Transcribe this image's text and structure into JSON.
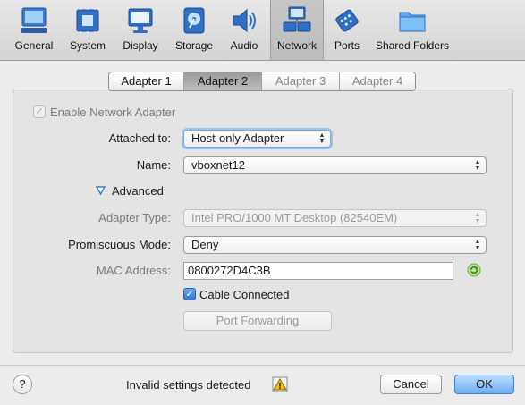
{
  "toolbar": {
    "items": [
      {
        "label": "General",
        "icon": "monitor-general-icon"
      },
      {
        "label": "System",
        "icon": "chip-icon"
      },
      {
        "label": "Display",
        "icon": "display-icon"
      },
      {
        "label": "Storage",
        "icon": "disk-icon"
      },
      {
        "label": "Audio",
        "icon": "speaker-icon"
      },
      {
        "label": "Network",
        "icon": "network-icon"
      },
      {
        "label": "Ports",
        "icon": "ports-icon"
      },
      {
        "label": "Shared Folders",
        "icon": "folder-icon"
      }
    ],
    "active": "Network"
  },
  "tabs": [
    "Adapter 1",
    "Adapter 2",
    "Adapter 3",
    "Adapter 4"
  ],
  "selected_tab": "Adapter 2",
  "form": {
    "enable_adapter_label": "Enable Network Adapter",
    "attached_to_label": "Attached to:",
    "attached_to_value": "Host-only Adapter",
    "name_label": "Name:",
    "name_value": "vboxnet12",
    "advanced_label": "Advanced",
    "adapter_type_label": "Adapter Type:",
    "adapter_type_value": "Intel PRO/1000 MT Desktop (82540EM)",
    "promiscuous_label": "Promiscuous Mode:",
    "promiscuous_value": "Deny",
    "mac_label": "MAC Address:",
    "mac_value": "0800272D4C3B",
    "cable_connected_label": "Cable Connected",
    "port_forwarding_label": "Port Forwarding"
  },
  "footer": {
    "help_label": "?",
    "status_text": "Invalid settings detected",
    "cancel_label": "Cancel",
    "ok_label": "OK"
  },
  "colors": {
    "accent": "#2f78d8",
    "primary_button": "#6aaef3",
    "warning": "#e8b000"
  }
}
